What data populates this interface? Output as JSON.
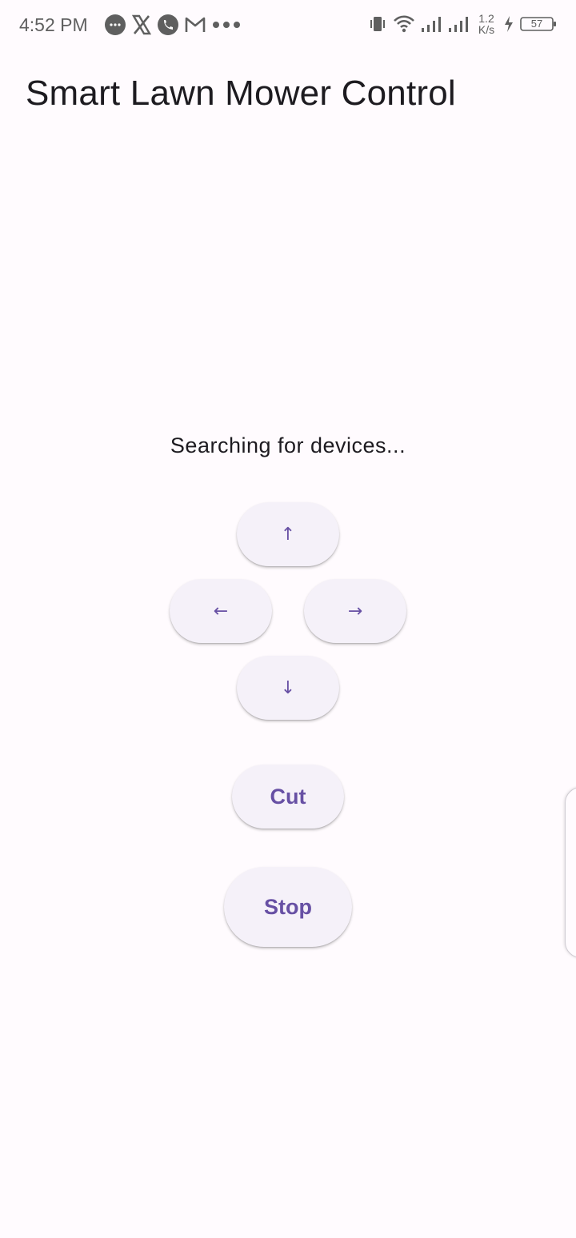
{
  "status_bar": {
    "time": "4:52 PM",
    "net_speed_value": "1.2",
    "net_speed_unit": "K/s",
    "battery": "57",
    "notification_icons": [
      "chat-bubble-icon",
      "x-icon",
      "phone-icon",
      "gmail-icon",
      "more-dots-icon"
    ],
    "system_icons": [
      "vibrate-icon",
      "wifi-icon",
      "signal-icon",
      "signal-icon",
      "charging-icon",
      "battery-icon"
    ]
  },
  "app_bar": {
    "title": "Smart Lawn Mower Control"
  },
  "status_message": "Searching for devices...",
  "controls": {
    "up_label": "↑",
    "left_label": "←",
    "right_label": "→",
    "down_label": "↓",
    "cut_label": "Cut",
    "stop_label": "Stop"
  },
  "colors": {
    "background": "#fffbfe",
    "button_surface": "#f5f1f9",
    "button_text": "#6750a4",
    "text_primary": "#1d1b20",
    "status_icon": "#5f5f5f"
  }
}
